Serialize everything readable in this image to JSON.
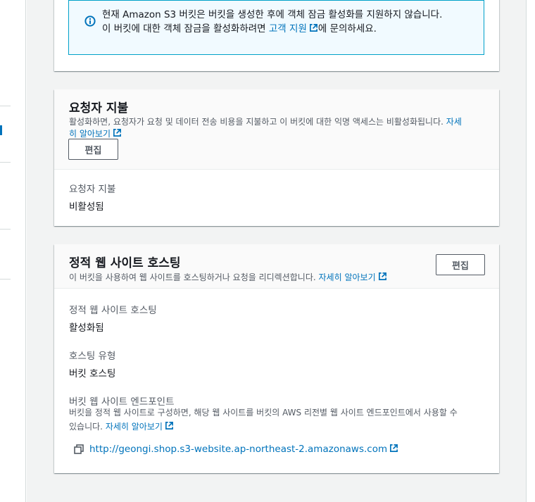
{
  "object_lock_alert": {
    "line1": "현재 Amazon S3 버킷은 버킷을 생성한 후에 객체 잠금 활성화를 지원하지 않습니다.",
    "line2_prefix": "이 버킷에 대한 객체 잠금을 활성화하려면 ",
    "line2_link": "고객 지원",
    "line2_suffix": "에 문의하세요."
  },
  "requester_pays": {
    "title": "요청자 지불",
    "description": "활성화하면, 요청자가 요청 및 데이터 전송 비용을 지불하고 이 버킷에 대한 익명 액세스는 비활성화됩니다.",
    "learn_more_1": "자세",
    "learn_more_2": "히 알아보기",
    "edit_label": "편집",
    "field_label": "요청자 지불",
    "field_value": "비활성됨"
  },
  "static_website": {
    "title": "정적 웹 사이트 호스팅",
    "description": "이 버킷을 사용하여 웹 사이트를 호스팅하거나 요청을 리디렉션합니다.",
    "learn_more": "자세히 알아보기",
    "edit_label": "편집",
    "hosting_label": "정적 웹 사이트 호스팅",
    "hosting_value": "활성화됨",
    "type_label": "호스팅 유형",
    "type_value": "버킷 호스팅",
    "endpoint_label": "버킷 웹 사이트 엔드포인트",
    "endpoint_desc_line1": "버킷을 정적 웹 사이트로 구성하면, 해당 웹 사이트를 버킷의 AWS 리전별 웹 사이트 엔드포인트에서 사용할 수",
    "endpoint_desc_line2": "있습니다.",
    "endpoint_learn_more": "자세히 알아보기",
    "endpoint_url": "http://geongi.shop.s3-website.ap-northeast-2.amazonaws.com"
  },
  "icons": {
    "info": "info-icon",
    "external": "external-link-icon",
    "copy": "copy-icon"
  },
  "colors": {
    "link": "#0073bb",
    "info_border": "#00a1c9",
    "info_bg": "#f1faff",
    "page_bg": "#f2f3f3"
  }
}
